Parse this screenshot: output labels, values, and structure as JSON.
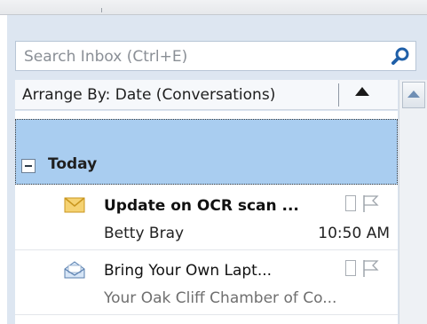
{
  "search": {
    "placeholder": "Search Inbox (Ctrl+E)"
  },
  "arrange": {
    "label": "Arrange By: Date (Conversations)"
  },
  "group": {
    "title": "Today"
  },
  "messages": [
    {
      "subject": "Update on OCR scan ...",
      "sender": "Betty Bray",
      "time": "10:50 AM",
      "icon": "unread-envelope-icon"
    },
    {
      "subject": "Bring Your Own Lapt...",
      "sender": "Your Oak Cliff Chamber of Co...",
      "time": "",
      "icon": "read-envelope-icon"
    }
  ],
  "colors": {
    "selection": "#a9cdf0",
    "pane": "#dde6f1",
    "accent": "#1f5fa8"
  }
}
